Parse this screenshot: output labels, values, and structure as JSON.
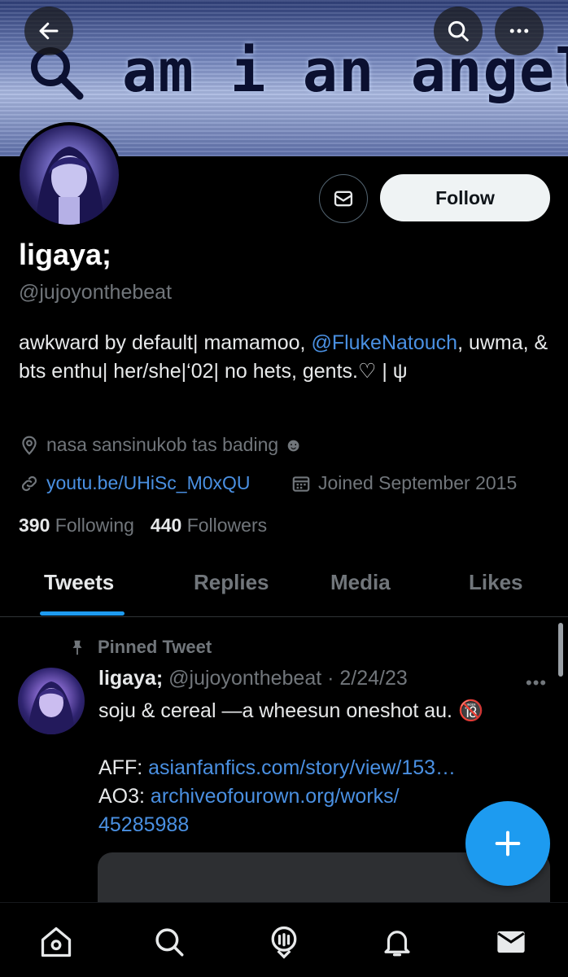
{
  "banner": {
    "text": "am i an angel",
    "colors": {
      "screen": "#8fa1d6"
    }
  },
  "header_buttons": {
    "back": "arrow-left-icon",
    "search": "search-icon",
    "more": "more-icon"
  },
  "profile": {
    "name": "ligaya;",
    "handle": "@jujoyonthebeat",
    "follow_label": "Follow",
    "bio": {
      "part1": "awkward by default| mamamoo, ",
      "mention": "@FlukeNatouch",
      "part2": ", uwma, & bts enthu| her/she|‘02| no hets, gents.♡ | ψ"
    },
    "location": "nasa sansinukob tas bading ☻",
    "website": "youtu.be/UHiSc_M0xQU",
    "joined": "Joined September 2015",
    "following_count": "390",
    "following_label": "Following",
    "followers_count": "440",
    "followers_label": "Followers"
  },
  "tabs": [
    {
      "label": "Tweets",
      "active": true
    },
    {
      "label": "Replies",
      "active": false
    },
    {
      "label": "Media",
      "active": false
    },
    {
      "label": "Likes",
      "active": false
    }
  ],
  "pinned_tweet": {
    "pinned_label": "Pinned Tweet",
    "name": "ligaya;",
    "handle": "@jujoyonthebeat",
    "date": "· 2/24/23",
    "more": "•••",
    "text_line1": "soju & cereal —a wheesun oneshot au. 🔞",
    "aff_label": "AFF: ",
    "aff_link": "asianfanfics.com/story/view/153…",
    "ao3_label": "AO3: ",
    "ao3_link_1": "archiveofourown.org/works/",
    "ao3_link_2": "45285988"
  },
  "colors": {
    "accent": "#1d9bf0",
    "link": "#4a90e2",
    "muted": "#71767b"
  },
  "bottom_nav": [
    "home-icon",
    "search-icon",
    "spaces-icon",
    "notifications-icon",
    "messages-icon"
  ]
}
